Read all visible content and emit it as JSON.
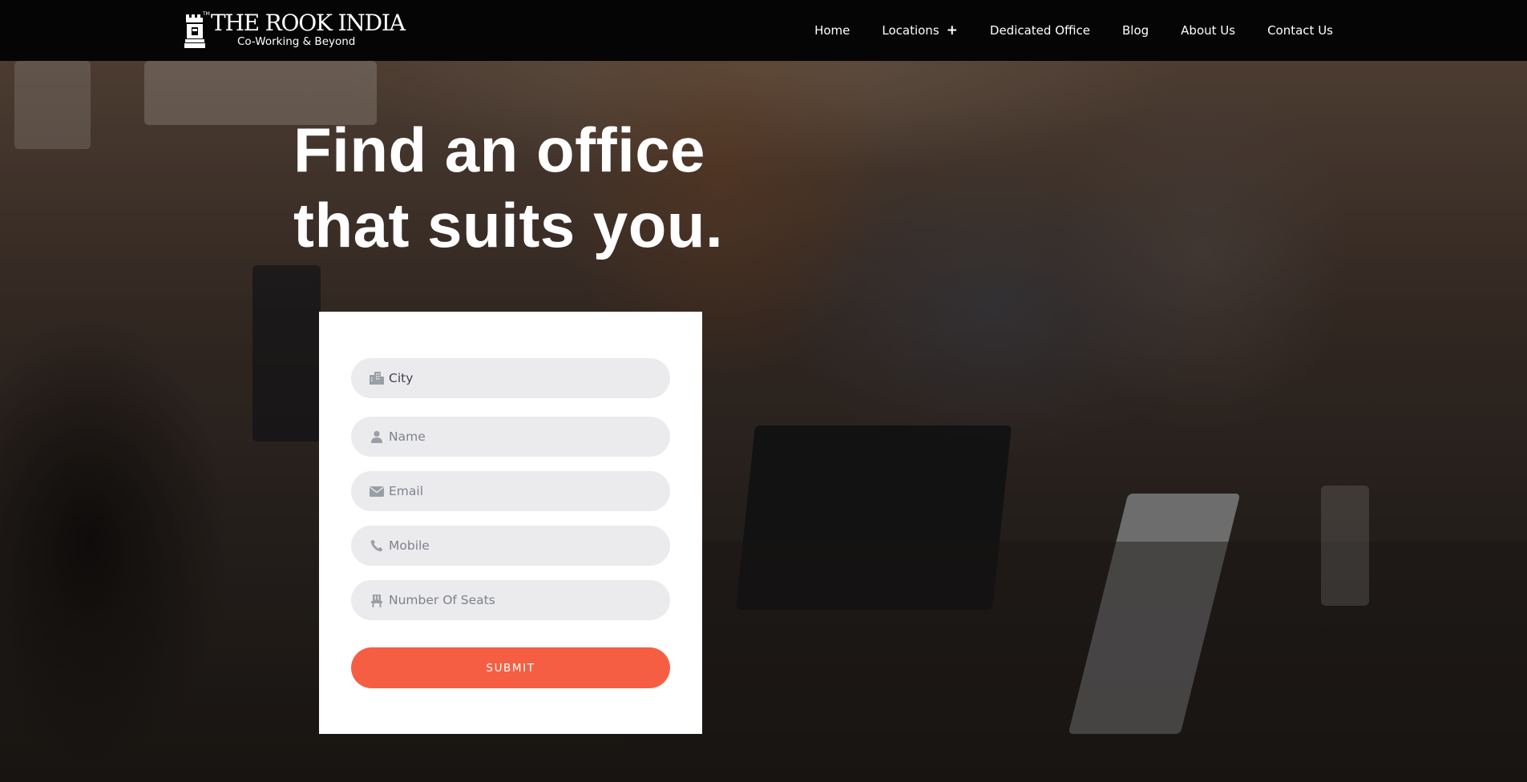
{
  "brand": {
    "name": "THE ROOK INDIA",
    "trademark": "TM",
    "tagline": "Co-Working & Beyond"
  },
  "nav": {
    "items": [
      {
        "label": "Home"
      },
      {
        "label": "Locations",
        "has_submenu": true,
        "submenu_indicator": "+"
      },
      {
        "label": "Dedicated Office"
      },
      {
        "label": "Blog"
      },
      {
        "label": "About Us"
      },
      {
        "label": "Contact Us"
      }
    ]
  },
  "hero": {
    "headline_line1": "Find an office",
    "headline_line2": "that suits you."
  },
  "form": {
    "fields": [
      {
        "placeholder": "City",
        "icon": "building-icon"
      },
      {
        "placeholder": "Name",
        "icon": "user-icon"
      },
      {
        "placeholder": "Email",
        "icon": "envelope-icon"
      },
      {
        "placeholder": "Mobile",
        "icon": "phone-icon"
      },
      {
        "placeholder": "Number Of Seats",
        "icon": "seat-icon"
      }
    ],
    "submit_label": "SUBMIT"
  },
  "colors": {
    "header_bg": "#050505",
    "accent": "#f65e44",
    "field_bg": "#ebebed",
    "card_bg": "#ffffff"
  }
}
